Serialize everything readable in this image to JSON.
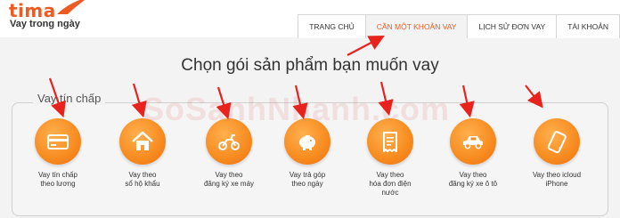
{
  "brand": {
    "name": "tima",
    "slogan": "Vay trong ngày"
  },
  "nav": {
    "tabs": [
      {
        "label": "TRANG CHỦ"
      },
      {
        "label": "CẦN MỘT KHOẢN VAY"
      },
      {
        "label": "LỊCH SỬ ĐƠN VAY"
      },
      {
        "label": "TÀI KHOẢN"
      }
    ],
    "active": "CẦN MỘT KHOẢN VAY"
  },
  "headline": "Chọn gói sản phẩm bạn muốn vay",
  "group_label": "Vay tín chấp",
  "watermark": "SoSanhNhanh.com",
  "products": [
    {
      "icon": "credit-card-icon",
      "line1": "Vay tín chấp",
      "line2": "theo lương",
      "line3": ""
    },
    {
      "icon": "house-icon",
      "line1": "Vay theo",
      "line2": "sổ hộ khẩu",
      "line3": ""
    },
    {
      "icon": "motorbike-icon",
      "line1": "Vay theo",
      "line2": "đăng ký xe máy",
      "line3": ""
    },
    {
      "icon": "piggy-bank-icon",
      "line1": "Vay trả góp",
      "line2": "theo ngày",
      "line3": ""
    },
    {
      "icon": "receipt-icon",
      "line1": "Vay theo",
      "line2": "hóa đơn điện",
      "line3": "nước"
    },
    {
      "icon": "car-icon",
      "line1": "Vay theo",
      "line2": "đăng ký xe ô tô",
      "line3": ""
    },
    {
      "icon": "phone-icon",
      "line1": "Vay theo icloud",
      "line2": "iPhone",
      "line3": ""
    }
  ],
  "colors": {
    "accent": "#ee5b22",
    "icon_orange": "#f78b1f",
    "arrow_red": "#e8231d"
  }
}
